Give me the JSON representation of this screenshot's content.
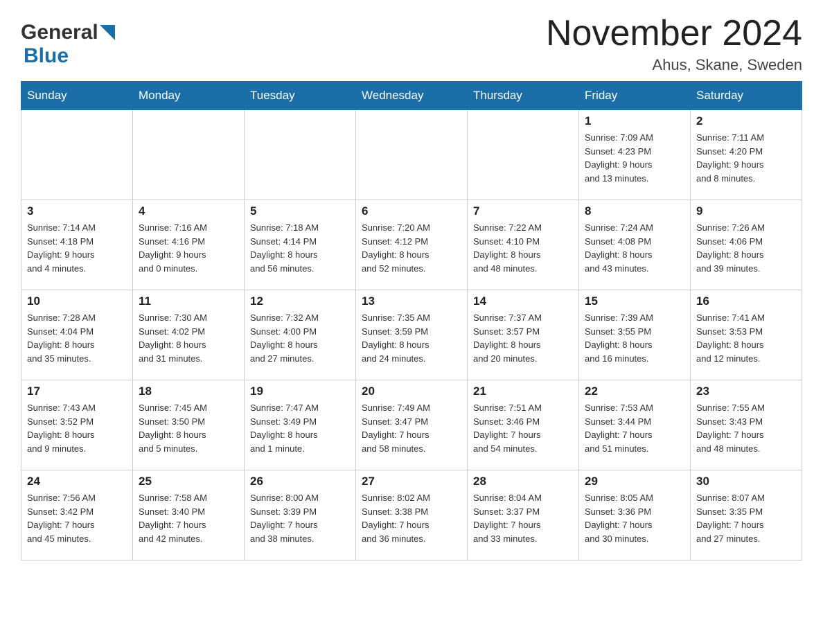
{
  "header": {
    "logo_general": "General",
    "logo_blue": "Blue",
    "month_title": "November 2024",
    "location": "Ahus, Skane, Sweden"
  },
  "weekdays": [
    "Sunday",
    "Monday",
    "Tuesday",
    "Wednesday",
    "Thursday",
    "Friday",
    "Saturday"
  ],
  "weeks": [
    [
      {
        "day": "",
        "info": ""
      },
      {
        "day": "",
        "info": ""
      },
      {
        "day": "",
        "info": ""
      },
      {
        "day": "",
        "info": ""
      },
      {
        "day": "",
        "info": ""
      },
      {
        "day": "1",
        "info": "Sunrise: 7:09 AM\nSunset: 4:23 PM\nDaylight: 9 hours\nand 13 minutes."
      },
      {
        "day": "2",
        "info": "Sunrise: 7:11 AM\nSunset: 4:20 PM\nDaylight: 9 hours\nand 8 minutes."
      }
    ],
    [
      {
        "day": "3",
        "info": "Sunrise: 7:14 AM\nSunset: 4:18 PM\nDaylight: 9 hours\nand 4 minutes."
      },
      {
        "day": "4",
        "info": "Sunrise: 7:16 AM\nSunset: 4:16 PM\nDaylight: 9 hours\nand 0 minutes."
      },
      {
        "day": "5",
        "info": "Sunrise: 7:18 AM\nSunset: 4:14 PM\nDaylight: 8 hours\nand 56 minutes."
      },
      {
        "day": "6",
        "info": "Sunrise: 7:20 AM\nSunset: 4:12 PM\nDaylight: 8 hours\nand 52 minutes."
      },
      {
        "day": "7",
        "info": "Sunrise: 7:22 AM\nSunset: 4:10 PM\nDaylight: 8 hours\nand 48 minutes."
      },
      {
        "day": "8",
        "info": "Sunrise: 7:24 AM\nSunset: 4:08 PM\nDaylight: 8 hours\nand 43 minutes."
      },
      {
        "day": "9",
        "info": "Sunrise: 7:26 AM\nSunset: 4:06 PM\nDaylight: 8 hours\nand 39 minutes."
      }
    ],
    [
      {
        "day": "10",
        "info": "Sunrise: 7:28 AM\nSunset: 4:04 PM\nDaylight: 8 hours\nand 35 minutes."
      },
      {
        "day": "11",
        "info": "Sunrise: 7:30 AM\nSunset: 4:02 PM\nDaylight: 8 hours\nand 31 minutes."
      },
      {
        "day": "12",
        "info": "Sunrise: 7:32 AM\nSunset: 4:00 PM\nDaylight: 8 hours\nand 27 minutes."
      },
      {
        "day": "13",
        "info": "Sunrise: 7:35 AM\nSunset: 3:59 PM\nDaylight: 8 hours\nand 24 minutes."
      },
      {
        "day": "14",
        "info": "Sunrise: 7:37 AM\nSunset: 3:57 PM\nDaylight: 8 hours\nand 20 minutes."
      },
      {
        "day": "15",
        "info": "Sunrise: 7:39 AM\nSunset: 3:55 PM\nDaylight: 8 hours\nand 16 minutes."
      },
      {
        "day": "16",
        "info": "Sunrise: 7:41 AM\nSunset: 3:53 PM\nDaylight: 8 hours\nand 12 minutes."
      }
    ],
    [
      {
        "day": "17",
        "info": "Sunrise: 7:43 AM\nSunset: 3:52 PM\nDaylight: 8 hours\nand 9 minutes."
      },
      {
        "day": "18",
        "info": "Sunrise: 7:45 AM\nSunset: 3:50 PM\nDaylight: 8 hours\nand 5 minutes."
      },
      {
        "day": "19",
        "info": "Sunrise: 7:47 AM\nSunset: 3:49 PM\nDaylight: 8 hours\nand 1 minute."
      },
      {
        "day": "20",
        "info": "Sunrise: 7:49 AM\nSunset: 3:47 PM\nDaylight: 7 hours\nand 58 minutes."
      },
      {
        "day": "21",
        "info": "Sunrise: 7:51 AM\nSunset: 3:46 PM\nDaylight: 7 hours\nand 54 minutes."
      },
      {
        "day": "22",
        "info": "Sunrise: 7:53 AM\nSunset: 3:44 PM\nDaylight: 7 hours\nand 51 minutes."
      },
      {
        "day": "23",
        "info": "Sunrise: 7:55 AM\nSunset: 3:43 PM\nDaylight: 7 hours\nand 48 minutes."
      }
    ],
    [
      {
        "day": "24",
        "info": "Sunrise: 7:56 AM\nSunset: 3:42 PM\nDaylight: 7 hours\nand 45 minutes."
      },
      {
        "day": "25",
        "info": "Sunrise: 7:58 AM\nSunset: 3:40 PM\nDaylight: 7 hours\nand 42 minutes."
      },
      {
        "day": "26",
        "info": "Sunrise: 8:00 AM\nSunset: 3:39 PM\nDaylight: 7 hours\nand 38 minutes."
      },
      {
        "day": "27",
        "info": "Sunrise: 8:02 AM\nSunset: 3:38 PM\nDaylight: 7 hours\nand 36 minutes."
      },
      {
        "day": "28",
        "info": "Sunrise: 8:04 AM\nSunset: 3:37 PM\nDaylight: 7 hours\nand 33 minutes."
      },
      {
        "day": "29",
        "info": "Sunrise: 8:05 AM\nSunset: 3:36 PM\nDaylight: 7 hours\nand 30 minutes."
      },
      {
        "day": "30",
        "info": "Sunrise: 8:07 AM\nSunset: 3:35 PM\nDaylight: 7 hours\nand 27 minutes."
      }
    ]
  ]
}
